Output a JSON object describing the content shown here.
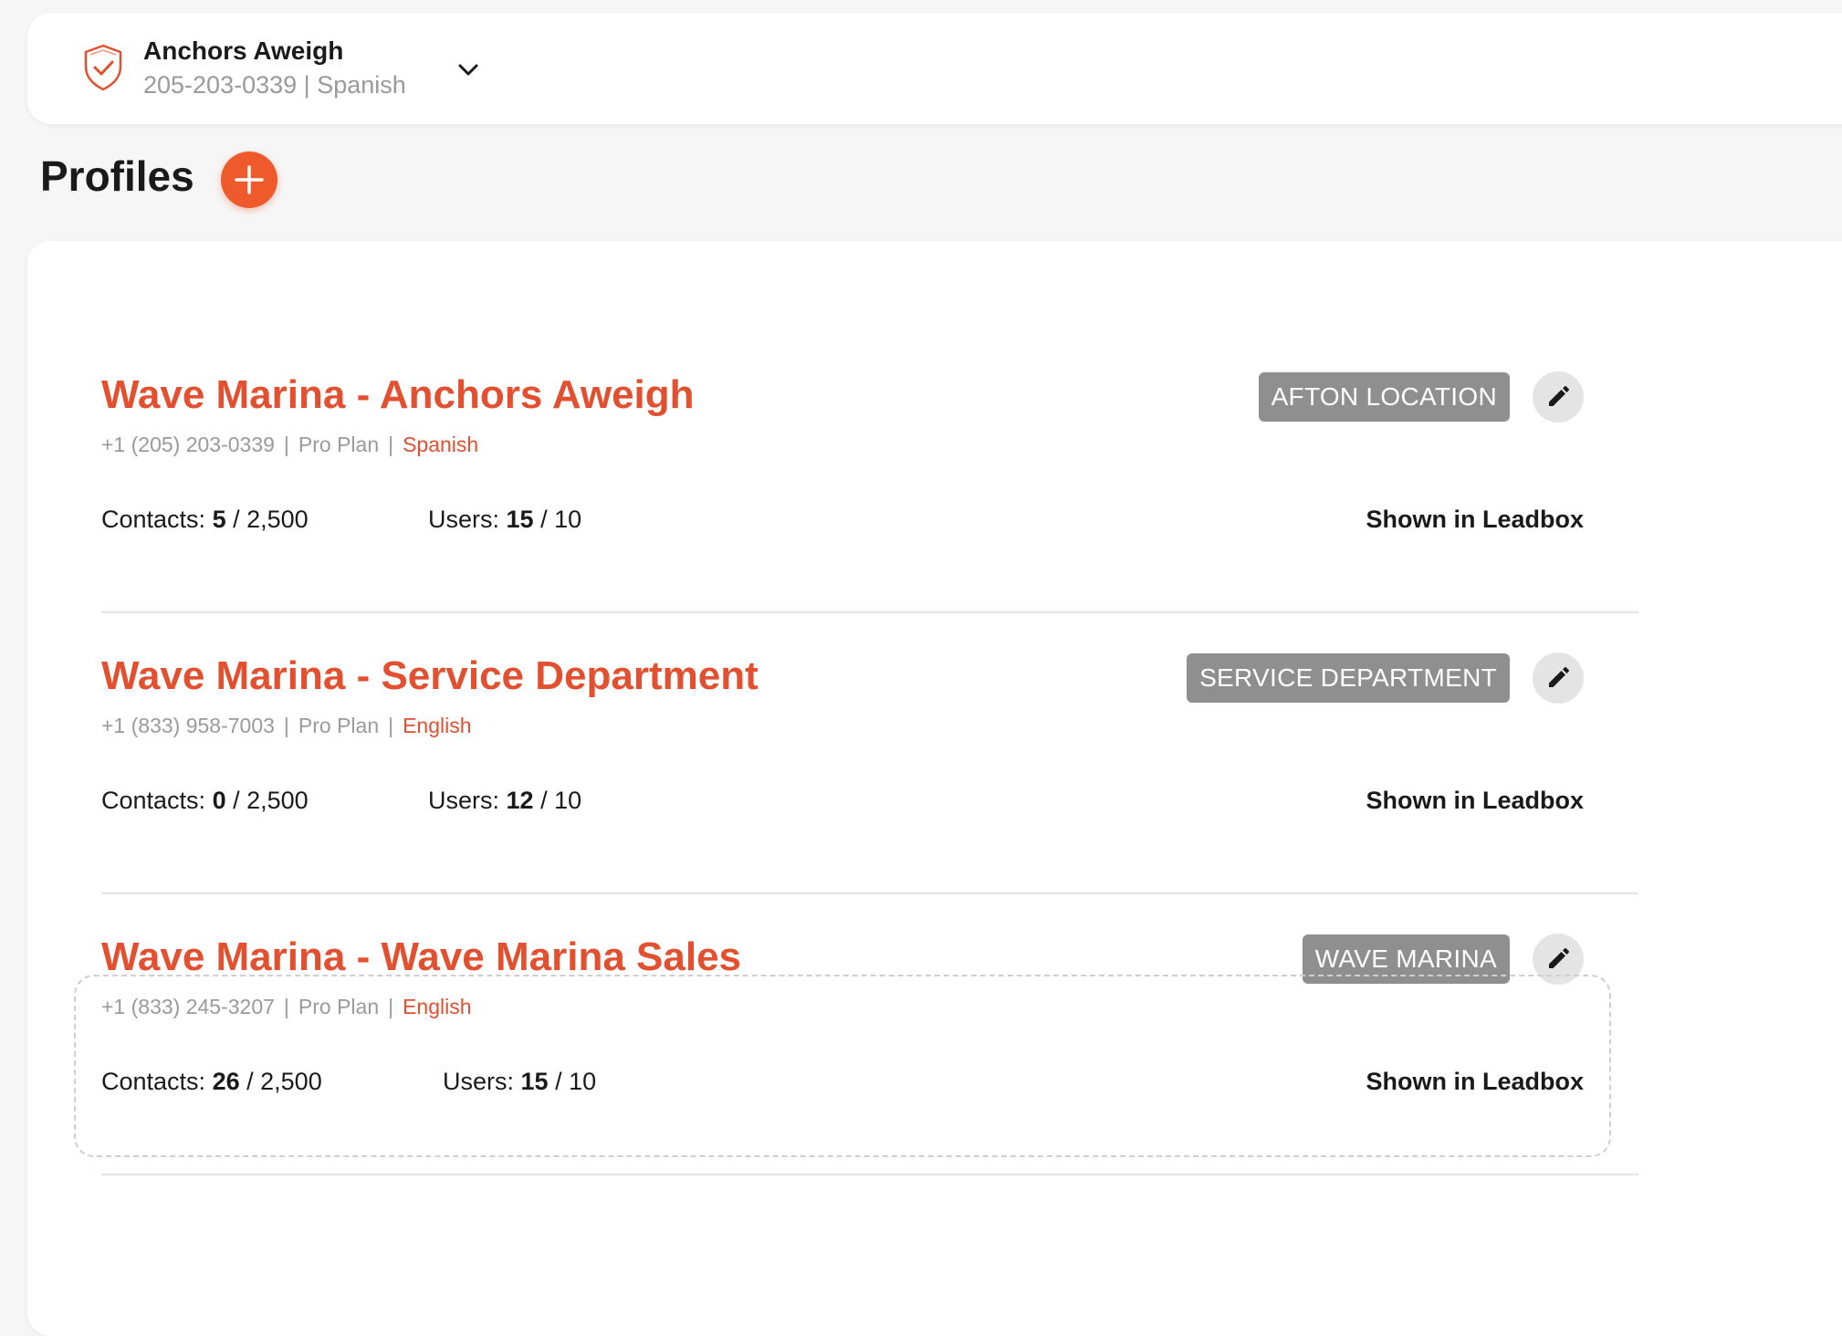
{
  "account": {
    "name": "Anchors Aweigh",
    "phone": "205-203-0339",
    "language": "Spanish",
    "separator": "|"
  },
  "page": {
    "title": "Profiles"
  },
  "colors": {
    "accent": "#e2502f",
    "add_button": "#ee5a2c",
    "tag_bg": "#8f8f8f"
  },
  "profiles": [
    {
      "name": "Wave Marina - Anchors Aweigh",
      "phone": "+1 (205) 203-0339",
      "plan": "Pro Plan",
      "language": "Spanish",
      "tag": "AFTON LOCATION",
      "contacts_label": "Contacts:",
      "contacts_used": "5",
      "contacts_limit": "/ 2,500",
      "users_label": "Users:",
      "users_used": "15",
      "users_limit": "/ 10",
      "leadbox": "Shown in Leadbox"
    },
    {
      "name": "Wave Marina - Service Department",
      "phone": "+1 (833) 958-7003",
      "plan": "Pro Plan",
      "language": "English",
      "tag": "SERVICE DEPARTMENT",
      "contacts_label": "Contacts:",
      "contacts_used": "0",
      "contacts_limit": "/ 2,500",
      "users_label": "Users:",
      "users_used": "12",
      "users_limit": "/ 10",
      "leadbox": "Shown in Leadbox"
    },
    {
      "name": "Wave Marina - Wave Marina Sales",
      "phone": "+1 (833) 245-3207",
      "plan": "Pro Plan",
      "language": "English",
      "tag": "WAVE MARINA",
      "contacts_label": "Contacts:",
      "contacts_used": "26",
      "contacts_limit": "/ 2,500",
      "users_label": "Users:",
      "users_used": "15",
      "users_limit": "/ 10",
      "leadbox": "Shown in Leadbox"
    }
  ]
}
